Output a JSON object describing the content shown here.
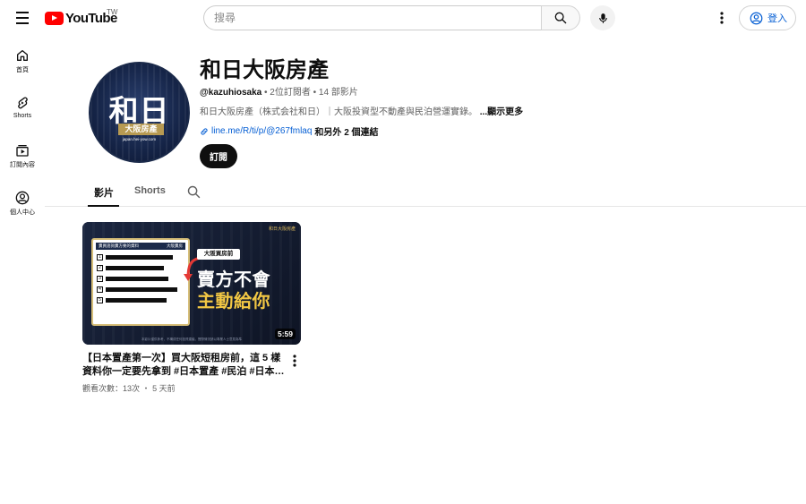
{
  "header": {
    "logo_text": "YouTube",
    "region": "TW",
    "search_placeholder": "搜尋",
    "signin_label": "登入"
  },
  "sidebar": {
    "items": [
      {
        "label": "首頁",
        "icon": "home-icon"
      },
      {
        "label": "Shorts",
        "icon": "shorts-icon"
      },
      {
        "label": "訂閱內容",
        "icon": "subscriptions-icon"
      },
      {
        "label": "個人中心",
        "icon": "account-icon"
      }
    ]
  },
  "channel": {
    "name": "和日大阪房產",
    "handle": "@kazuhiosaka",
    "subscribers": "2位訂閱者",
    "video_count": "14 部影片",
    "description": "和日大阪房產（株式会社和日）｜大阪投資型不動產與民泊營運實錄。",
    "more_label": "...顯示更多",
    "link_text": "line.me/R/ti/p/@267fmlaq",
    "other_links": "和另外 2 個連結",
    "subscribe_label": "訂閱",
    "avatar": {
      "main": "和日",
      "sub": "大阪房產",
      "url": "japan.hei-yow.com"
    }
  },
  "tabs": [
    {
      "label": "影片",
      "active": true
    },
    {
      "label": "Shorts",
      "active": false
    }
  ],
  "videos": [
    {
      "title": "【日本置產第一次】買大阪短租房前，這 5 樣資料你一定要先拿到 #日本置產 #民泊 #日本買房",
      "views": "觀看次數：13次",
      "age": "5 天前",
      "duration": "5:59",
      "thumbnail": {
        "brand": "和日大阪房產",
        "doc_title": "賣買諮詢賣方要的資料",
        "doc_tag": "大阪賣房",
        "rows": [
          "1",
          "2",
          "3",
          "4",
          "5"
        ],
        "tag": "大阪買房前",
        "line1": "賣方不會",
        "line2": "主動給你",
        "footer": "本影片僅供參考，不構成任何投資建議，實際情況請以專業人士意見為準"
      }
    }
  ],
  "colors": {
    "brand_red": "#ff0000",
    "link_blue": "#065fd4",
    "gold": "#f2c744"
  }
}
